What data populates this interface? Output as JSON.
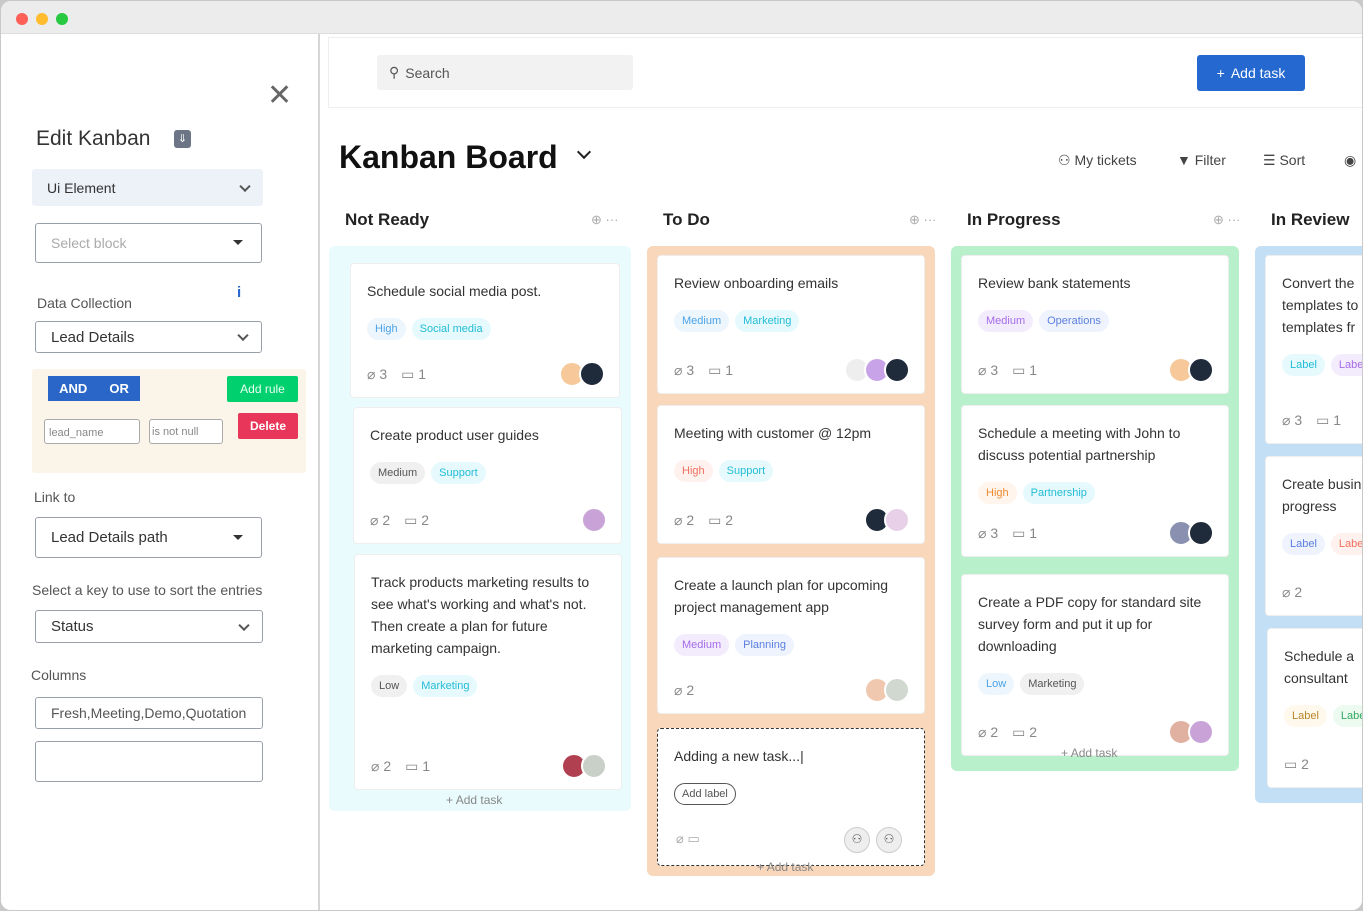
{
  "sidebar": {
    "title": "Edit Kanban",
    "ui_element": "Ui Element",
    "select_block_placeholder": "Select block",
    "data_collection_label": "Data Collection",
    "data_collection": "Lead Details",
    "and_label": "AND",
    "or_label": "OR",
    "add_rule": "Add rule",
    "delete": "Delete",
    "rule_field": "lead_name",
    "rule_op": "is not null",
    "link_to_label": "Link to",
    "link_to": "Lead Details path",
    "sort_label": "Select a key to use to sort the entries",
    "sort_key": "Status",
    "columns_label": "Columns",
    "columns_value": "Fresh,Meeting,Demo,Quotation",
    "extra_value": ""
  },
  "topbar": {
    "search_placeholder": "Search",
    "add_task": "Add task"
  },
  "board": {
    "title": "Kanban Board",
    "my_tickets": "My tickets",
    "filter": "Filter",
    "sort": "Sort",
    "add_task": "Add task",
    "columns": [
      {
        "name": "Not Ready",
        "color": "#e9fbfd",
        "cards": [
          {
            "title": "Schedule social media post.",
            "tags": [
              {
                "text": "High",
                "bg": "#eef6fd",
                "fg": "#4aa3e8"
              },
              {
                "text": "Social media",
                "bg": "#e6fafd",
                "fg": "#22bcd6"
              }
            ],
            "attachments": "3",
            "comments": "1",
            "avatars": [
              "#f6c89a",
              "#1f2a3a"
            ]
          },
          {
            "title": "Create product user guides",
            "tags": [
              {
                "text": "Medium",
                "bg": "#f0f0f0",
                "fg": "#555"
              },
              {
                "text": "Support",
                "bg": "#e6fafd",
                "fg": "#22bcd6"
              }
            ],
            "attachments": "2",
            "comments": "2",
            "avatars": [
              "#c9a3d8"
            ]
          },
          {
            "title": "Track products  marketing results to see what's working and what's not. Then create a plan for future marketing campaign.",
            "tags": [
              {
                "text": "Low",
                "bg": "#f0f0f0",
                "fg": "#555"
              },
              {
                "text": "Marketing",
                "bg": "#e6fafd",
                "fg": "#22bcd6"
              }
            ],
            "attachments": "2",
            "comments": "1",
            "avatars": [
              "#b04050",
              "#c8d0c8"
            ]
          }
        ]
      },
      {
        "name": "To Do",
        "color": "#f8d7bb",
        "cards": [
          {
            "title": "Review onboarding emails",
            "tags": [
              {
                "text": "Medium",
                "bg": "#eef6fd",
                "fg": "#4aa3e8"
              },
              {
                "text": "Marketing",
                "bg": "#e6fafd",
                "fg": "#22bcd6"
              }
            ],
            "attachments": "3",
            "comments": "1",
            "avatars": [
              "#eeeeee",
              "#c9a3e8",
              "#1f2a3a"
            ]
          },
          {
            "title": "Meeting with customer @ 12pm",
            "tags": [
              {
                "text": "High",
                "bg": "#fff1ee",
                "fg": "#f07060"
              },
              {
                "text": "Support",
                "bg": "#e6fafd",
                "fg": "#22bcd6"
              }
            ],
            "attachments": "2",
            "comments": "2",
            "avatars": [
              "#1f2a3a",
              "#e8d0e8"
            ]
          },
          {
            "title": "Create a launch plan for upcoming project management app",
            "tags": [
              {
                "text": "Medium",
                "bg": "#f3ecfd",
                "fg": "#a66be8"
              },
              {
                "text": "Planning",
                "bg": "#eef3fd",
                "fg": "#5b7fe0"
              }
            ],
            "attachments": "2",
            "comments": "",
            "avatars": [
              "#f0c8b0",
              "#d0d8d0"
            ]
          }
        ],
        "new_task": {
          "text": "Adding a new task...|",
          "add_label": "Add label"
        }
      },
      {
        "name": "In Progress",
        "color": "#b8f0cc",
        "cards": [
          {
            "title": "Review bank statements",
            "tags": [
              {
                "text": "Medium",
                "bg": "#f3ecfd",
                "fg": "#a66be8"
              },
              {
                "text": "Operations",
                "bg": "#eef3fd",
                "fg": "#5b7fe0"
              }
            ],
            "attachments": "3",
            "comments": "1",
            "avatars": [
              "#f6c89a",
              "#1f2a3a"
            ]
          },
          {
            "title": "Schedule a meeting with John to discuss potential partnership",
            "tags": [
              {
                "text": "High",
                "bg": "#fff5ec",
                "fg": "#f08a30"
              },
              {
                "text": "Partnership",
                "bg": "#e6fafd",
                "fg": "#22bcd6"
              }
            ],
            "attachments": "3",
            "comments": "1",
            "avatars": [
              "#8a90b0",
              "#1f2a3a"
            ]
          },
          {
            "title": "Create a PDF copy for standard site survey form and put it up for downloading",
            "tags": [
              {
                "text": "Low",
                "bg": "#eef6fd",
                "fg": "#4aa3e8"
              },
              {
                "text": "Marketing",
                "bg": "#f0f0f0",
                "fg": "#555"
              }
            ],
            "attachments": "2",
            "comments": "2",
            "avatars": [
              "#e0b0a0",
              "#c9a3d8"
            ]
          }
        ]
      },
      {
        "name": "In Review",
        "color": "#c3dff5",
        "cards": [
          {
            "title": "Convert the templates to templates fr",
            "tags": [
              {
                "text": "Label",
                "bg": "#e6fafd",
                "fg": "#22bcd6"
              },
              {
                "text": "Label",
                "bg": "#f3ecfd",
                "fg": "#a66be8"
              }
            ],
            "attachments": "3",
            "comments": "1",
            "avatars": []
          },
          {
            "title": "Create busin progress",
            "tags": [
              {
                "text": "Label",
                "bg": "#eef3fd",
                "fg": "#5b7fe0"
              },
              {
                "text": "Label",
                "bg": "#fff1ee",
                "fg": "#f07060"
              }
            ],
            "attachments": "2",
            "comments": "",
            "avatars": []
          },
          {
            "title": "Schedule a consultant",
            "tags": [
              {
                "text": "Label",
                "bg": "#fff8ec",
                "fg": "#b8862a"
              },
              {
                "text": "Label",
                "bg": "#ecfaf0",
                "fg": "#30a860"
              }
            ],
            "attachments": "",
            "comments": "2",
            "avatars": []
          }
        ]
      }
    ]
  }
}
